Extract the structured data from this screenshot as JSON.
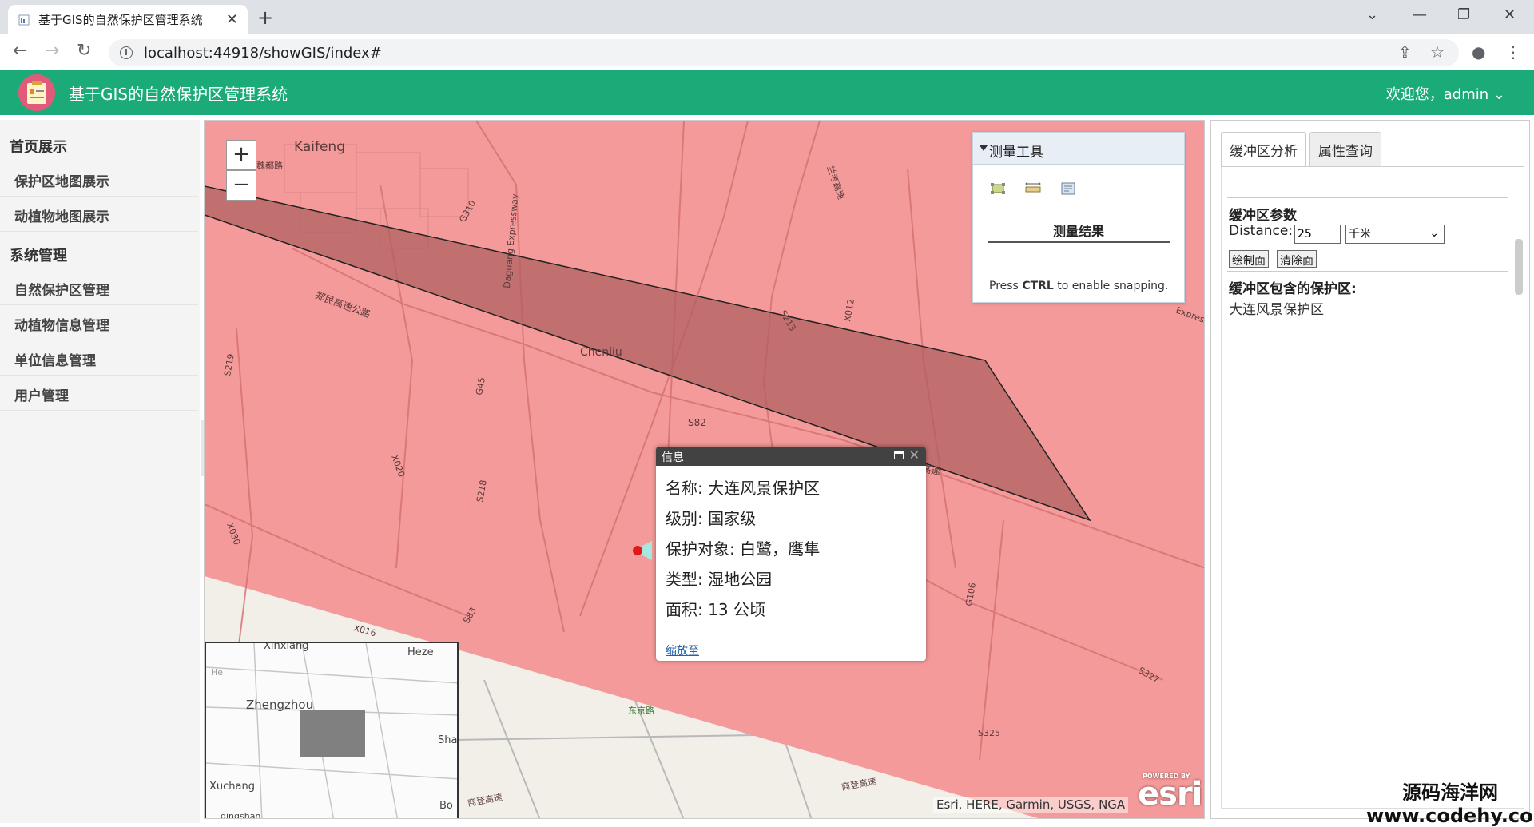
{
  "browser": {
    "tab_title": "基于GIS的自然保护区管理系统",
    "url": "localhost:44918/showGIS/index#"
  },
  "header": {
    "title": "基于GIS的自然保护区管理系统",
    "user": "欢迎您，admin"
  },
  "sidebar": {
    "groups": [
      {
        "title": "首页展示",
        "items": [
          "保护区地图展示",
          "动植物地图展示"
        ]
      },
      {
        "title": "系统管理",
        "items": [
          "自然保护区管理",
          "动植物信息管理",
          "单位信息管理",
          "用户管理"
        ]
      }
    ]
  },
  "map": {
    "labels": {
      "kaifeng": "Kaifeng",
      "chenliu": "Chenliu",
      "road_sheng": "郑民高速公路",
      "road_minjing": "民高速",
      "road_s82": "S82",
      "road_s219": "S219",
      "road_s218": "S218",
      "road_g45": "G45",
      "road_s83": "S83",
      "road_x020": "X020",
      "road_x030": "X030",
      "road_x016": "X016",
      "road_s213": "S213",
      "road_x012": "X012",
      "road_g310": "G310",
      "road_g106": "G106",
      "road_s327": "S327",
      "road_s325": "S325",
      "road_daguang": "Daguang Expressway",
      "road_lanhe": "兰考高速",
      "road_shangdeng": "商登高速",
      "road_shangdeng2": "商登高速",
      "road_express": "Express",
      "road_cyan": "东京路",
      "road_xiyao": "魏都路"
    },
    "overview_labels": {
      "xinxiang": "Xinxiang",
      "heze": "Heze",
      "zhengzhou": "Zhengzhou",
      "shang": "Shan",
      "xuchang": "Xuchang",
      "bo": "Bo",
      "he": "He",
      "dingshan": "dingshan"
    },
    "attribution": "Esri, HERE, Garmin, USGS, NGA",
    "esri_text": "esri",
    "esri_powered": "POWERED BY"
  },
  "measure": {
    "title": "测量工具",
    "result_label": "测量结果",
    "hint_prefix": "Press",
    "hint_key": "CTRL",
    "hint_suffix": "to enable snapping."
  },
  "popup": {
    "title": "信息",
    "rows": [
      "名称: 大连风景保护区",
      "级别: 国家级",
      "保护对象: 白鹭，鹰隼",
      "类型: 湿地公园",
      "面积: 13 公顷"
    ],
    "zoom_link": "缩放至"
  },
  "right_panel": {
    "tabs": [
      "缓冲区分析",
      "属性查询"
    ],
    "params_title": "缓冲区参数",
    "distance_label": "Distance:",
    "distance_value": "25",
    "unit": "千米",
    "draw_button": "绘制面",
    "clear_button": "清除面",
    "contains_title": "缓冲区包含的保护区:",
    "result": "大连风景保护区"
  },
  "watermark": {
    "line1": "源码海洋网",
    "line2": "www.codehy.com"
  },
  "colors": {
    "header_green": "#1aab79",
    "buffer_fill": "#f59a9a",
    "polygon_fill": "#b06060"
  }
}
